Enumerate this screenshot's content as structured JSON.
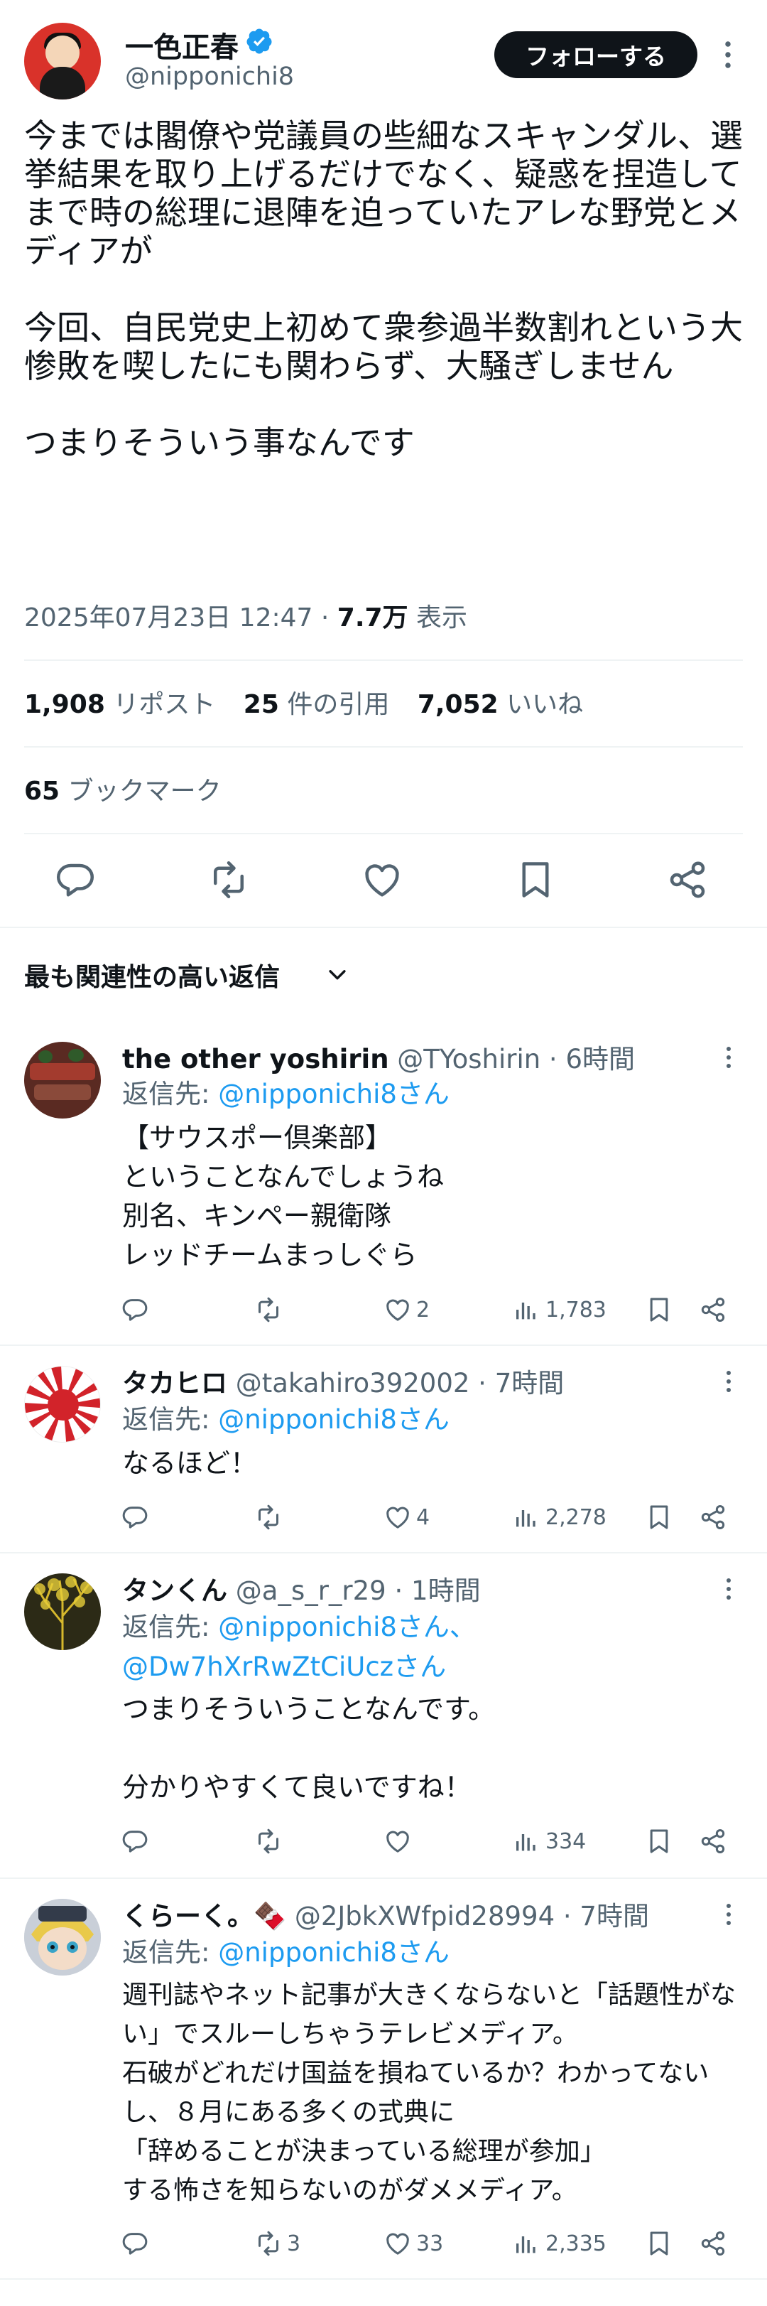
{
  "tweet": {
    "author_name": "一色正春",
    "author_handle": "@nipponichi8",
    "follow_label": "フォローする",
    "text": "今までは閣僚や党議員の些細なスキャンダル、選挙結果を取り上げるだけでなく、疑惑を捏造してまで時の総理に退陣を迫っていたアレな野党とメディアが\n\n今回、自民党史上初めて衆参過半数割れという大惨敗を喫したにも関わらず、大騒ぎしません\n\nつまりそういう事なんです",
    "date": "2025年07月23日 12:47",
    "views": "7.7万",
    "views_label": "表示",
    "reposts": "1,908",
    "reposts_label": "リポスト",
    "quotes": "25",
    "quotes_label": "件の引用",
    "likes": "7,052",
    "likes_label": "いいね",
    "bookmarks": "65",
    "bookmarks_label": "ブックマーク"
  },
  "sort_label": "最も関連性の高い返信",
  "reply_to_prefix": "返信先: ",
  "replies": [
    {
      "name": "the other yoshirin",
      "handle": "@TYoshirin",
      "time": "6時間",
      "reply_to": "@nipponichi8さん",
      "text": "【サウスポー倶楽部】\nということなんでしょうね\n別名、キンペー親衛隊\nレッドチームまっしぐら",
      "replies": "",
      "reposts": "",
      "likes": "2",
      "views": "1,783"
    },
    {
      "name": "タカヒロ",
      "handle": "@takahiro392002",
      "time": "7時間",
      "reply_to": "@nipponichi8さん",
      "text": "なるほど！",
      "replies": "",
      "reposts": "",
      "likes": "4",
      "views": "2,278"
    },
    {
      "name": "タンくん",
      "handle": "@a_s_r_r29",
      "time": "1時間",
      "reply_to": "@nipponichi8さん、",
      "reply_to_2": "@Dw7hXrRwZtCiUczさん",
      "text": "つまりそういうことなんです。\n\n分かりやすくて良いですね！",
      "replies": "",
      "reposts": "",
      "likes": "",
      "views": "334"
    },
    {
      "name": "くらーく。🍫",
      "handle": "@2JbkXWfpid28994",
      "time": "7時間",
      "reply_to": "@nipponichi8さん",
      "text": "週刊誌やネット記事が大きくならないと「話題性がない」でスルーしちゃうテレビメディア。\n石破がどれだけ国益を損ねているか？わかってないし、８月にある多くの式典に\n「辞めることが決まっている総理が参加」\nする怖さを知らないのがダメメディア。",
      "replies": "",
      "reposts": "3",
      "likes": "33",
      "views": "2,335"
    }
  ],
  "colors": {
    "text": "#0f1419",
    "secondary": "#536471",
    "link": "#1d9bf0",
    "verified": "#1d9bf0",
    "divider": "#eff3f4",
    "follow_bg": "#0f1419"
  },
  "icons": [
    "reply-icon",
    "repost-icon",
    "like-icon",
    "bookmark-icon",
    "share-icon",
    "views-icon",
    "verified-badge-icon",
    "more-icon",
    "chevron-down-icon"
  ]
}
